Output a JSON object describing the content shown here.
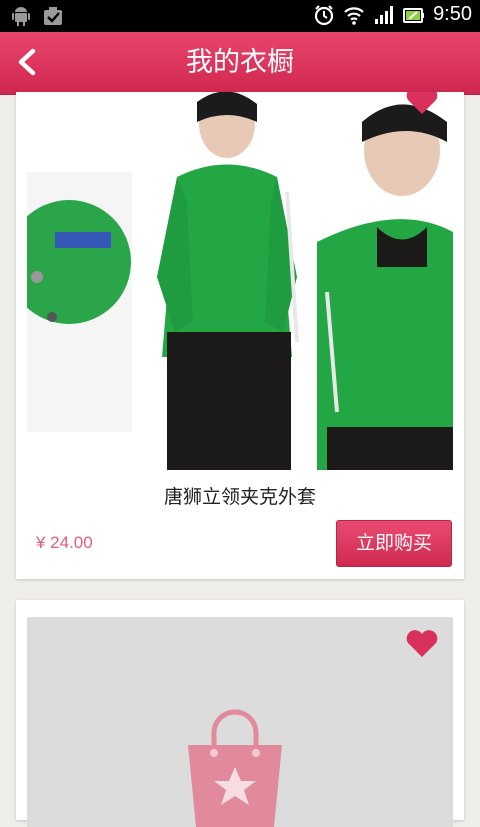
{
  "status_bar": {
    "time": "9:50",
    "left_icons": [
      "android-icon",
      "task-check-icon"
    ],
    "right_icons": [
      "alarm-icon",
      "wifi-icon",
      "signal-icon",
      "battery-icon"
    ]
  },
  "header": {
    "title": "我的衣橱",
    "back_icon": "back-arrow-icon",
    "background": "#dc3560"
  },
  "products": [
    {
      "name": "唐狮立领夹克外套",
      "price": "¥ 24.00",
      "buy_label": "立即购买",
      "favorite_icon": "heart-icon",
      "image": "green-jacket-models-photo"
    },
    {
      "favorite_icon": "heart-icon",
      "image": "placeholder-shopping-bag-icon"
    }
  ],
  "colors": {
    "accent": "#dc3560",
    "price": "#e55b80",
    "page_bg": "#efeeea"
  }
}
